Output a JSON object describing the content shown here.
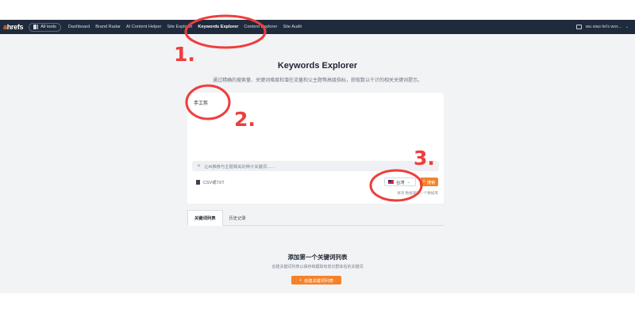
{
  "nav": {
    "logo_a": "a",
    "logo_rest": "hrefs",
    "all_tools": "All tools",
    "links": [
      "Dashboard",
      "Brand Radar",
      "AI Content Helper",
      "Site Explorer",
      "Keywords Explorer",
      "Content Explorer",
      "Site Audit"
    ],
    "active_index": 4,
    "account": "wu xiao lei's wor..."
  },
  "main": {
    "title": "Keywords Explorer",
    "subtitle": "通过精确的搜索量、关键词难度和潜在流量和父主题等高级指标，获取数以千计的相关关键词提示。",
    "keyword_input_value": "手工剪",
    "ai_prompt_placeholder": "让AI推荐与主题相关的种子关键词……",
    "csv_label": "CSV或TXT",
    "country_label": "台湾",
    "search_label": "搜索",
    "credits_note": "将消 数据库的一个数据库"
  },
  "tabs": [
    {
      "label": "关键词列表"
    },
    {
      "label": "历史记录"
    }
  ],
  "empty_state": {
    "title": "添加第一个关键词列表",
    "subtitle": "创建关键词列表以保存和跟踪有意识群体名的关键词",
    "button_label": "创建关键词列表"
  },
  "annotations": {
    "labels": [
      "1.",
      "2.",
      "3."
    ],
    "color": "#ef3d3d"
  },
  "colors": {
    "nav_bg": "#1f2a3c",
    "accent": "#f5822a",
    "content_bg": "#f2f3f5"
  },
  "icons": [
    "grid-icon",
    "screen-icon",
    "chevron-down-icon",
    "spark-icon",
    "file-icon",
    "flag-icon",
    "search-icon",
    "plus-icon"
  ]
}
